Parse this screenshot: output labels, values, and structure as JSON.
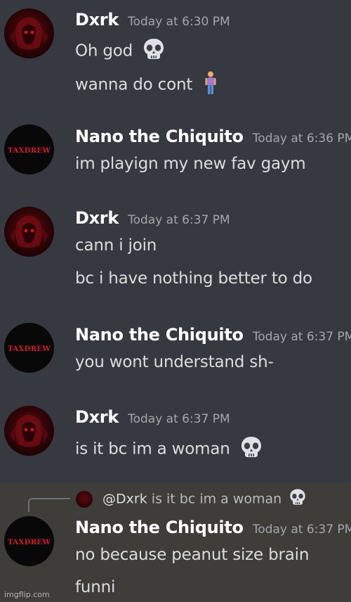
{
  "messages": [
    {
      "author": "Dxrk",
      "timestamp": "Today at 6:30 PM",
      "lines": [
        "Oh god",
        "wanna do cont"
      ],
      "emojis": [
        "skull-emoji",
        "person-standing-emoji"
      ]
    },
    {
      "author": "Nano the Chiquito",
      "timestamp": "Today at 6:36 PM",
      "lines": [
        "im playign my new fav gaym"
      ]
    },
    {
      "author": "Dxrk",
      "timestamp": "Today at 6:37 PM",
      "lines": [
        "cann i join",
        "bc i have nothing better to do"
      ]
    },
    {
      "author": "Nano the Chiquito",
      "timestamp": "Today at 6:37 PM",
      "lines": [
        "you wont understand sh-"
      ]
    },
    {
      "author": "Dxrk",
      "timestamp": "Today at 6:37 PM",
      "lines": [
        "is it bc im a woman"
      ],
      "emojis": [
        "skull-emoji"
      ]
    },
    {
      "author": "Nano the Chiquito",
      "timestamp": "Today at 6:37 PM",
      "lines": [
        "no because peanut size brain",
        "funni"
      ],
      "reply": {
        "mention": "@Dxrk",
        "text": "is it bc im a woman"
      }
    }
  ],
  "avatar_text": {
    "nano": "TAXDREW"
  },
  "watermark": "imgflip.com",
  "colors": {
    "background": "#36393f",
    "reply_highlight": "#3e3d3a",
    "username": "#ffffff",
    "message_text": "#dcddde",
    "timestamp": "#a3a6aa"
  }
}
